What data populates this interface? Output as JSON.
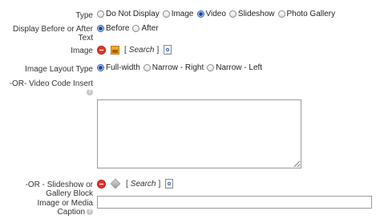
{
  "type": {
    "label": "Type",
    "options": [
      "Do Not Display",
      "Image",
      "Video",
      "Slideshow",
      "Photo Gallery"
    ],
    "selected": "Video"
  },
  "display": {
    "label": "Display Before or After Text",
    "options": [
      "Before",
      "After"
    ],
    "selected": "Before"
  },
  "image": {
    "label": "Image",
    "search_label": "Search"
  },
  "layout": {
    "label": "Image Layout Type",
    "options": [
      "Full-width",
      "Narrow - Right",
      "Narrow - Left"
    ],
    "selected": "Full-width"
  },
  "video": {
    "label": "-OR- Video Code Insert",
    "value": ""
  },
  "slideshow": {
    "label": "-OR - Slideshow or Gallery Block",
    "search_label": "Search"
  },
  "caption": {
    "label": "Image or Media Caption",
    "value": ""
  },
  "help_glyph": "?"
}
